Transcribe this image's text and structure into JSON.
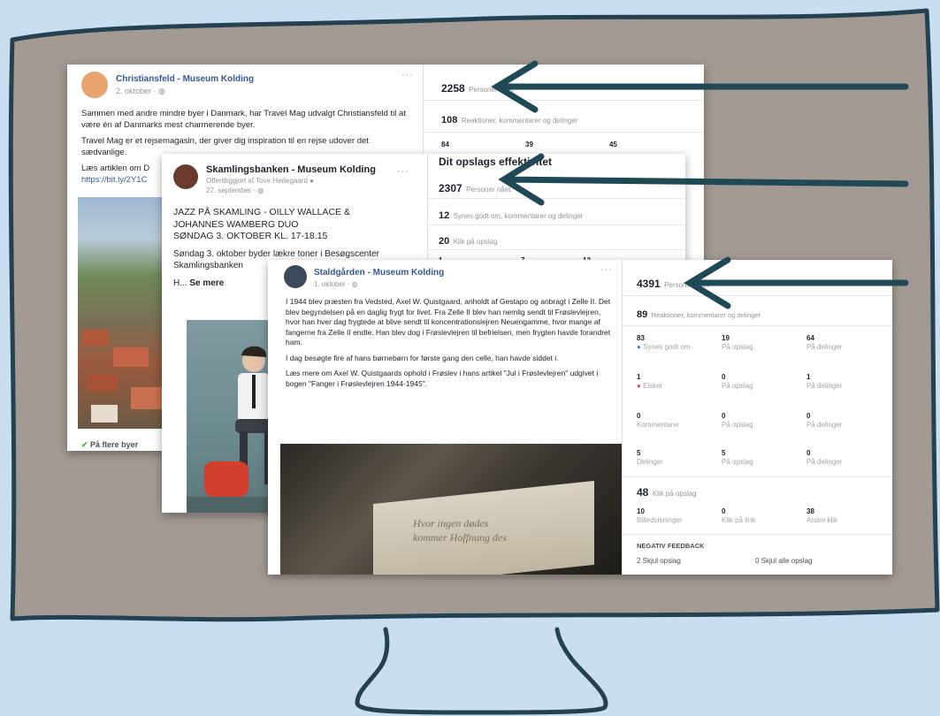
{
  "colors": {
    "background": "#c9def0",
    "screen_fill": "#a39a93",
    "outline": "#234150",
    "arrow": "#1f4a55",
    "link_blue": "#385898"
  },
  "icons": [
    "monitor-outline",
    "monitor-stand",
    "arrow-left",
    "ellipsis-icon",
    "globe-icon"
  ],
  "card1": {
    "page_name": "Christiansfeld - Museum Kolding",
    "date": "2. oktober · ",
    "menu": "···",
    "text": [
      "Sammen med andre mindre byer i Danmark, har Travel Mag udvalgt Christiansfeld til at være én af Danmarks mest charmerende byer.",
      "Travel Mag er et rejsemagasin, der giver dig inspiration til en rejse udover det sædvanlige.",
      "Læs artiklen om D",
      "https://bit.ly/2Y1C"
    ],
    "footer": "På flere byer",
    "stats": {
      "reach": "2258",
      "reach_label": "Personer nået",
      "engagement": "108",
      "engagement_label": "Reaktioner, kommentarer og delinger",
      "mini": [
        "84",
        "39",
        "45"
      ]
    }
  },
  "card2": {
    "page_name": "Skamlingsbanken - Museum Kolding",
    "posted_by": "Offentliggjort af Tove Hedegaard",
    "date": "27. september · ",
    "menu": "···",
    "title_lines": [
      "JAZZ PÅ SKAMLING - OILLY WALLACE &",
      "JOHANNES WAMBERG DUO",
      "SØNDAG 3. OKTOBER KL. 17-18.15"
    ],
    "body": "Søndag 3. oktober byder lækre toner i Besøgscenter Skamlingsbanken",
    "see_more_prefix": "H... ",
    "see_more": "Se mere",
    "stats": {
      "heading": "Dit opslags effektivitet",
      "reach": "2307",
      "reach_label": "Personer nået",
      "engagement": "12",
      "engagement_label": "Synes godt om, kommentarer og delinger",
      "clicks": "20",
      "clicks_label": "Klik på opslag",
      "mini": [
        "1",
        "7",
        "12"
      ]
    }
  },
  "card3": {
    "page_name": "Staldgården - Museum Kolding",
    "date": "1. oktober · ",
    "menu": "···",
    "paragraphs": [
      "I 1944 blev præsten fra Vedsted, Axel W. Quistgaard, anholdt af Gestapo og anbragt i Zelle II. Det blev begyndelsen på en daglig frygt for livet. Fra Zelle II blev han nemlig sendt til Frøslevlejren, hvor han hver dag frygtede at blive sendt til koncentrationslejren Neuengamme, hvor mange af fangerne fra Zelle II endte. Han blev dog i Frøslevlejren til befrielsen, men frygten havde forandret ham.",
      "I dag besøgte fire af hans børnebørn for første gang den celle, han havde siddet i.",
      "Læs mere om Axel W. Quistgaards ophold i Frøslev i hans artikel \"Jul i Frøslevlejren\" udgivet i bogen \"Fanger i Frøslevlejren 1944-1945\"."
    ],
    "photo_text": [
      "Hvor ingen dødes",
      "kommer Hoffnung des"
    ],
    "stats": {
      "reach": "4391",
      "reach_label": "Personer nået",
      "engagement": "89",
      "engagement_label": "Reaktioner, kommentarer og delinger",
      "grid": [
        {
          "value": "83",
          "label": "Synes godt om"
        },
        {
          "value": "19",
          "label": "På opslag"
        },
        {
          "value": "64",
          "label": "På delinger"
        },
        {
          "value": "1",
          "label": "Elsker"
        },
        {
          "value": "0",
          "label": "På opslag"
        },
        {
          "value": "1",
          "label": "På delinger"
        },
        {
          "value": "0",
          "label": "Kommentarer"
        },
        {
          "value": "0",
          "label": "På opslag"
        },
        {
          "value": "0",
          "label": "På delinger"
        },
        {
          "value": "5",
          "label": "Delinger"
        },
        {
          "value": "5",
          "label": "På opslag"
        },
        {
          "value": "0",
          "label": "På delinger"
        }
      ],
      "clicks": "48",
      "clicks_label": "Klik på opslag",
      "clicks_grid": [
        {
          "value": "10",
          "label": "Billedvisninger"
        },
        {
          "value": "0",
          "label": "Klik på link"
        },
        {
          "value": "38",
          "label": "Andre klik"
        }
      ],
      "negative_heading": "NEGATIV FEEDBACK",
      "hide_post": "2 Skjul opslag",
      "hide_all": "0 Skjul alle opslag"
    }
  }
}
